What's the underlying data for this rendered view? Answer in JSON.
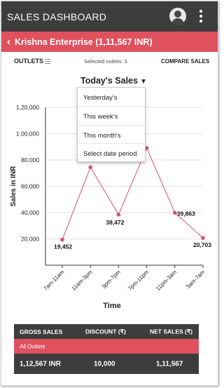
{
  "appbar": {
    "title": "SALES DASHBOARD",
    "profile_icon": "account-circle-icon",
    "menu_icon": "more-vert-icon"
  },
  "header": {
    "back_icon": "chevron-left-icon",
    "title": "Krishna Enterprise (1,11,567 INR)"
  },
  "filters": {
    "outlets_label": "OUTLETS",
    "outlets_icon": "list-icon",
    "selected_outlets": "Selected outlets: 3",
    "compare_label": "COMPARE SALES"
  },
  "period": {
    "selected": "Today's Sales",
    "options": [
      "Yesterday's",
      "This week's",
      "This month's",
      "Select date period"
    ]
  },
  "chart_data": {
    "type": "line",
    "xlabel": "Time",
    "ylabel": "Sales in INR",
    "categories": [
      "7am-11am",
      "11am-3pm",
      "3pm-7pm",
      "7pm-11pm",
      "11pm-3am",
      "3am-7am"
    ],
    "values": [
      19452,
      74486,
      38472,
      89054,
      39863,
      20703
    ],
    "labels": [
      "19,452",
      "74,486",
      "38,472",
      "54",
      "39,863",
      "20,703"
    ],
    "ylim": [
      0,
      120000
    ],
    "yticks": [
      20000,
      40000,
      60000,
      80000,
      100000,
      120000
    ],
    "ytick_labels": [
      "20,000",
      "40,000",
      "60,000",
      "80,000",
      "1,00,000",
      "1,20,000"
    ],
    "grid": true,
    "line_color": "#d6546a"
  },
  "summary": {
    "headers": [
      "GROSS SALES",
      "DISCOUNT (₹)",
      "NET SALES (₹)"
    ],
    "band": "All Outlets",
    "values": [
      "1,12,567 INR",
      "10,000",
      "1,11,567"
    ]
  },
  "colors": {
    "dark": "#3d3d3d",
    "accent": "#e0515e"
  }
}
